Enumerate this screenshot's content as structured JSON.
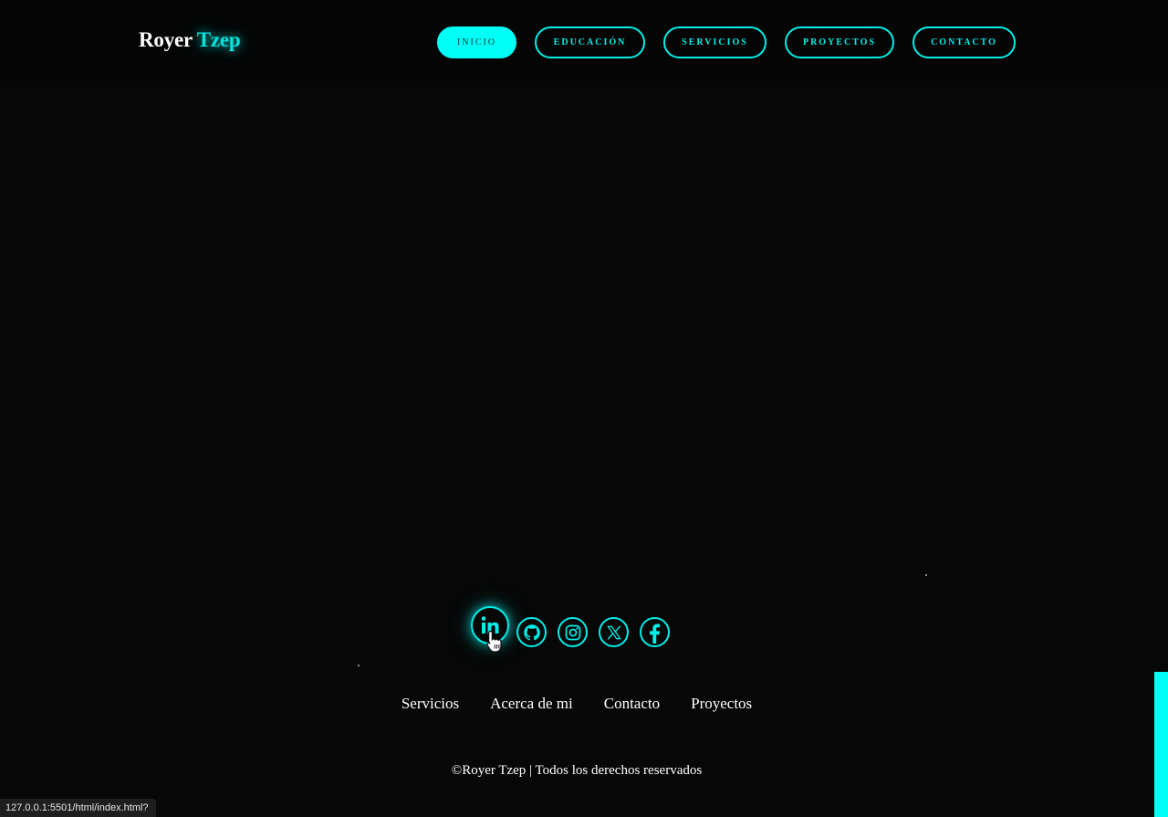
{
  "header": {
    "logo_first": "Royer",
    "logo_second": "Tzep",
    "nav": [
      {
        "label": "INICIO",
        "active": true
      },
      {
        "label": "EDUCACIÓN",
        "active": false
      },
      {
        "label": "SERVICIOS",
        "active": false
      },
      {
        "label": "PROYECTOS",
        "active": false
      },
      {
        "label": "CONTACTO",
        "active": false
      }
    ]
  },
  "socials": [
    {
      "icon": "linkedin-icon",
      "hovered": true
    },
    {
      "icon": "github-icon",
      "hovered": false
    },
    {
      "icon": "instagram-icon",
      "hovered": false
    },
    {
      "icon": "x-icon",
      "hovered": false
    },
    {
      "icon": "facebook-icon",
      "hovered": false
    }
  ],
  "footer": {
    "links": [
      "Servicios",
      "Acerca de mi",
      "Contacto",
      "Proyectos"
    ],
    "copyright": "©Royer Tzep | Todos los derechos reservados"
  },
  "status_bar": {
    "url": "127.0.0.1:5501/html/index.html?"
  },
  "colors": {
    "background": "#070707",
    "accent": "#00eee8",
    "text": "#ffffff"
  }
}
